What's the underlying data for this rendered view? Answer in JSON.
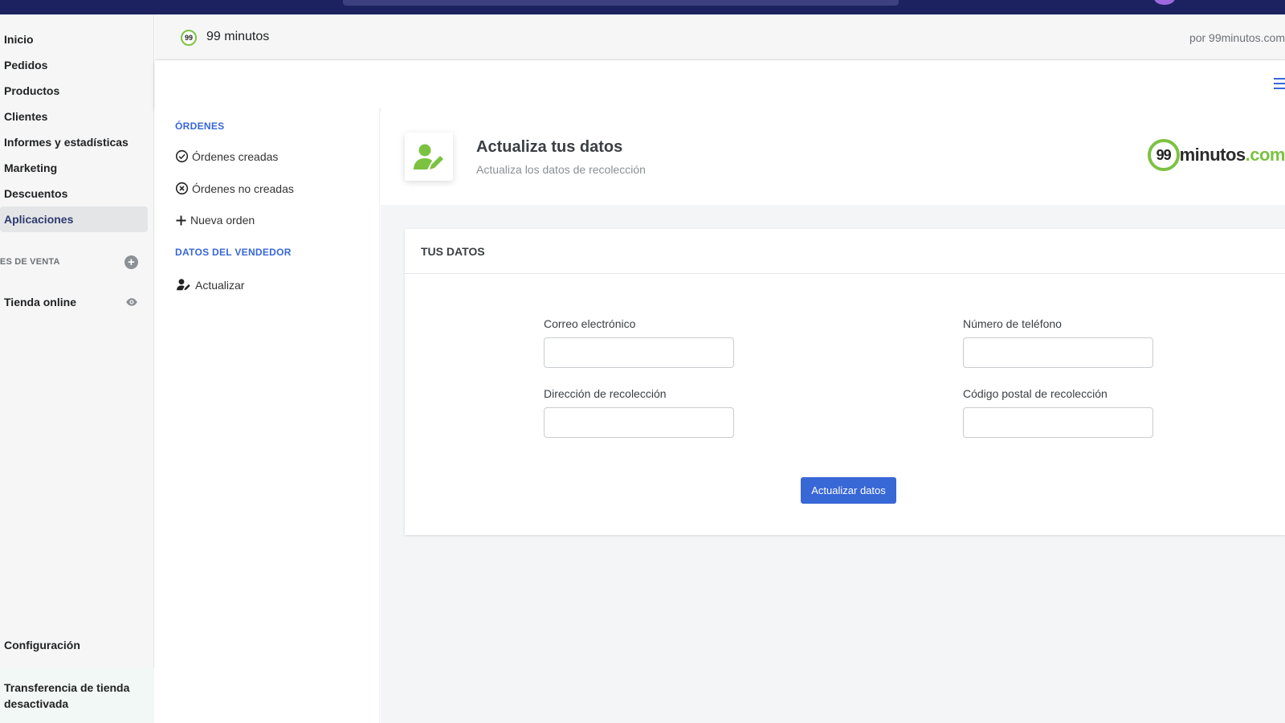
{
  "admin_nav": {
    "items": [
      {
        "label": "Inicio"
      },
      {
        "label": "Pedidos"
      },
      {
        "label": "Productos"
      },
      {
        "label": "Clientes"
      },
      {
        "label": "Informes y estadísticas"
      },
      {
        "label": "Marketing"
      },
      {
        "label": "Descuentos"
      },
      {
        "label": "Aplicaciones"
      }
    ],
    "sales_channels_heading": "LES DE VENTA",
    "online_store": "Tienda online",
    "settings": "Configuración",
    "transfer_notice": "Transferencia de tienda desactivada"
  },
  "app_header": {
    "logo_text": "99",
    "app_name": "99 minutos",
    "by_text": "por 99minutos.com"
  },
  "app_menu": {
    "orders_heading": "ÓRDENES",
    "created_orders": "Órdenes creadas",
    "not_created_orders": "Órdenes no creadas",
    "new_order": "Nueva orden",
    "seller_heading": "DATOS DEL VENDEDOR",
    "update": "Actualizar"
  },
  "page": {
    "title": "Actualiza tus datos",
    "subtitle": "Actualiza los datos de recolección",
    "brand_number": "99",
    "brand_name": "minutos",
    "brand_domain": ".com"
  },
  "form": {
    "card_title": "TUS DATOS",
    "email_label": "Correo electrónico",
    "email_value": "",
    "phone_label": "Número de teléfono",
    "phone_value": "",
    "address_label": "Dirección de recolección",
    "address_value": "",
    "zip_label": "Código postal de recolección",
    "zip_value": "",
    "submit_label": "Actualizar datos"
  },
  "colors": {
    "topbar": "#1c2260",
    "accent": "#3867d6",
    "brand_green": "#7cc242"
  }
}
